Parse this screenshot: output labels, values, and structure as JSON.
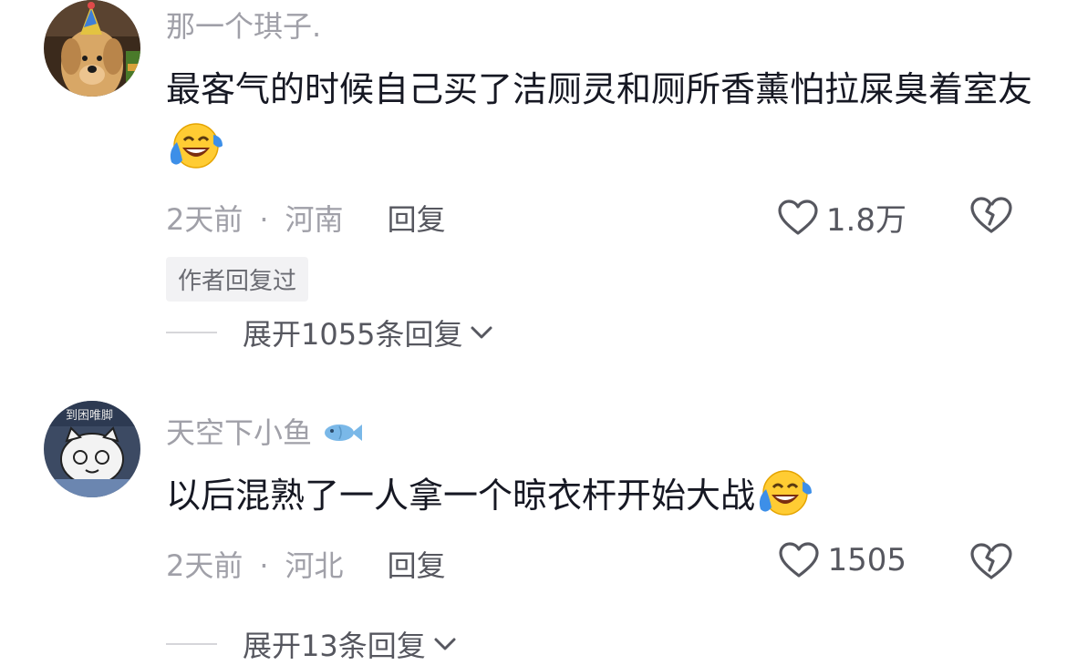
{
  "comments": [
    {
      "username": "那一个琪子.",
      "content": "最客气的时候自己买了洁厕灵和厕所香薰怕拉屎臭着室友",
      "emoji": "laughing-crying-emoji",
      "time": "2天前",
      "location": "河南",
      "separator": "·",
      "reply_label": "回复",
      "likes": "1.8万",
      "author_tag": "作者回复过",
      "expand_label": "展开1055条回复"
    },
    {
      "username": "天空下小鱼",
      "username_badge": "fish-icon",
      "avatar_text": "到困唯脚",
      "content": "以后混熟了一人拿一个晾衣杆开始大战",
      "emoji": "laughing-crying-emoji",
      "time": "2天前",
      "location": "河北",
      "separator": "·",
      "reply_label": "回复",
      "likes": "1505",
      "expand_label": "展开13条回复"
    }
  ],
  "colors": {
    "secondary_text": "#a0a0a8",
    "primary_text": "#161823",
    "action_text": "#56575f",
    "tag_bg": "#f2f2f4"
  }
}
